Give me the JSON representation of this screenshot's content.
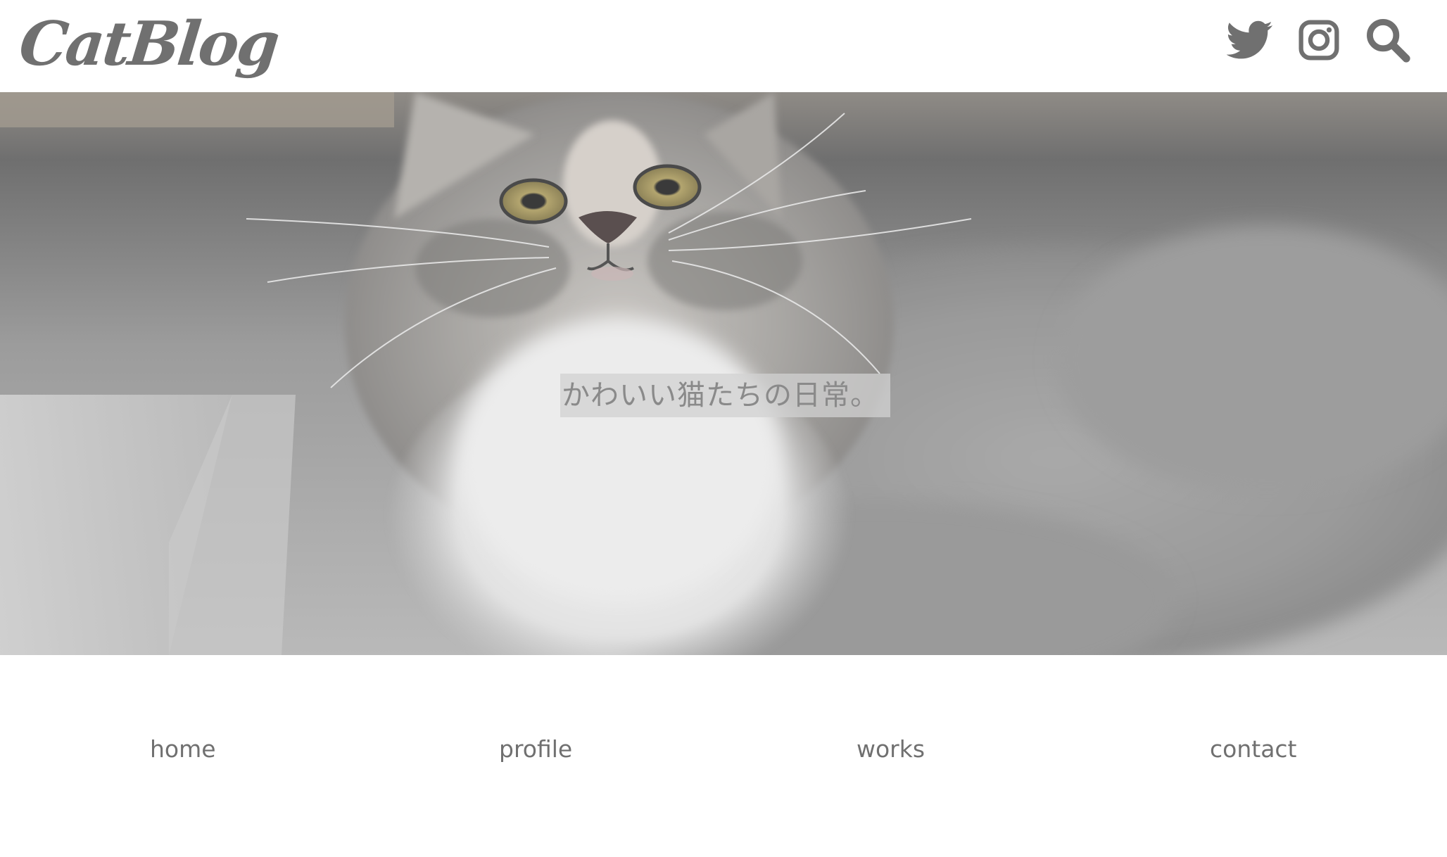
{
  "header": {
    "logo_text": "CatBlog",
    "icons": {
      "twitter": "twitter-icon",
      "instagram": "instagram-icon",
      "search": "search-icon"
    }
  },
  "hero": {
    "caption": "かわいい猫たちの日常。"
  },
  "nav": {
    "items": [
      {
        "label": "home"
      },
      {
        "label": "profile"
      },
      {
        "label": "works"
      },
      {
        "label": "contact"
      }
    ]
  },
  "colors": {
    "text_gray": "#707070",
    "background": "#ffffff",
    "caption_bg": "#d2d2d2"
  }
}
